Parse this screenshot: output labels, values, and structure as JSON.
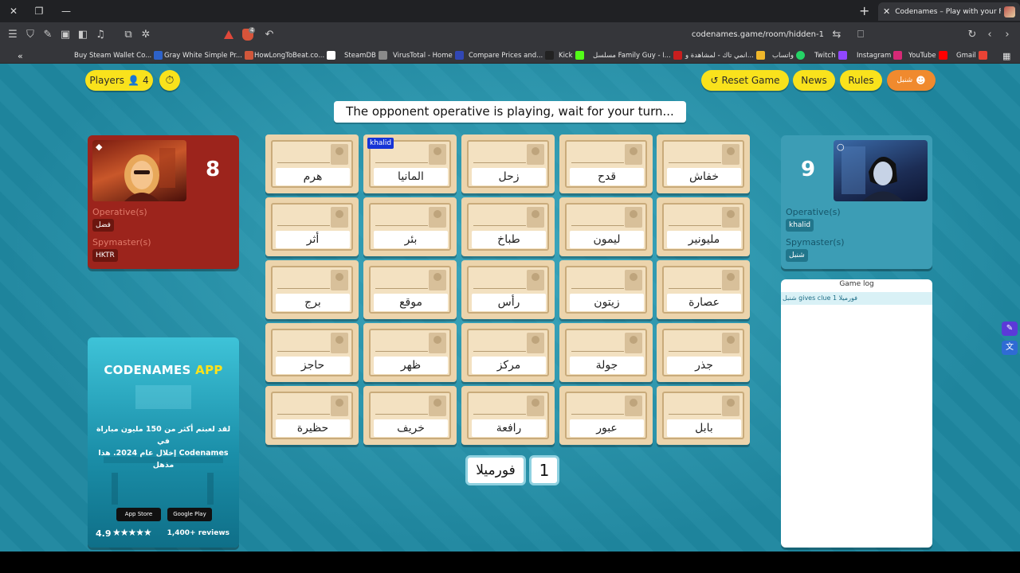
{
  "browser": {
    "active_tab": "Codenames – Play with your Frie",
    "address": "codenames.game/room/hidden-1",
    "shield_count": "4",
    "bookmarks": [
      "Buy Steam Wallet Co...",
      "Gray White Simple Pr...",
      "HowLongToBeat.co...",
      "SteamDB",
      "VirusTotal - Home",
      "Compare Prices and...",
      "Kick",
      "مسلسل Family Guy - ا...",
      "انمي تاك - لمشاهدة و...",
      "واتساب",
      "Twitch",
      "Instagram",
      "YouTube",
      "Gmail"
    ]
  },
  "header": {
    "players_label": "Players",
    "players_count": "4",
    "reset_label": "Reset Game",
    "news_label": "News",
    "rules_label": "Rules",
    "user_label": "شنبل"
  },
  "status_message": "The opponent operative is playing, wait for your turn...",
  "red_team": {
    "score": "8",
    "operatives_label": "Operative(s)",
    "operative_name": "فضل",
    "spymasters_label": "Spymaster(s)",
    "spymaster_name": "HKTR",
    "color": "#9c241c"
  },
  "blue_team": {
    "score": "9",
    "operatives_label": "Operative(s)",
    "operative_name": "khalid",
    "spymasters_label": "Spymaster(s)",
    "spymaster_name": "شنبل",
    "color": "#3c9db5"
  },
  "board": {
    "rows": [
      [
        {
          "word": "هرم"
        },
        {
          "word": "المانيا",
          "tag": "khalid"
        },
        {
          "word": "زحل"
        },
        {
          "word": "قدح"
        },
        {
          "word": "خفاش"
        }
      ],
      [
        {
          "word": "أثر"
        },
        {
          "word": "بئر"
        },
        {
          "word": "طباخ"
        },
        {
          "word": "ليمون"
        },
        {
          "word": "مليونير"
        }
      ],
      [
        {
          "word": "برج"
        },
        {
          "word": "موقع"
        },
        {
          "word": "رأس"
        },
        {
          "word": "زيتون"
        },
        {
          "word": "عصارة"
        }
      ],
      [
        {
          "word": "حاجز"
        },
        {
          "word": "ظهر"
        },
        {
          "word": "مركز"
        },
        {
          "word": "جولة"
        },
        {
          "word": "جذر"
        }
      ],
      [
        {
          "word": "حظيرة"
        },
        {
          "word": "خريف"
        },
        {
          "word": "رافعة"
        },
        {
          "word": "عبور"
        },
        {
          "word": "بابل"
        }
      ]
    ]
  },
  "clue": {
    "word": "فورميلا",
    "number": "1"
  },
  "game_log": {
    "title": "Game log",
    "entries": [
      "شنبل gives clue فورميلا 1"
    ]
  },
  "ad": {
    "title_main": "CODENAMES",
    "title_app": "APP",
    "text_line1": "لقد لعبتم أكثر من 150 مليون مباراة في",
    "text_line2": "Codenames إخلال عام 2024. هذا مذهل",
    "app_store": "App Store",
    "google_play": "Google Play",
    "rating": "4.9",
    "reviews": "1,400+ reviews"
  }
}
